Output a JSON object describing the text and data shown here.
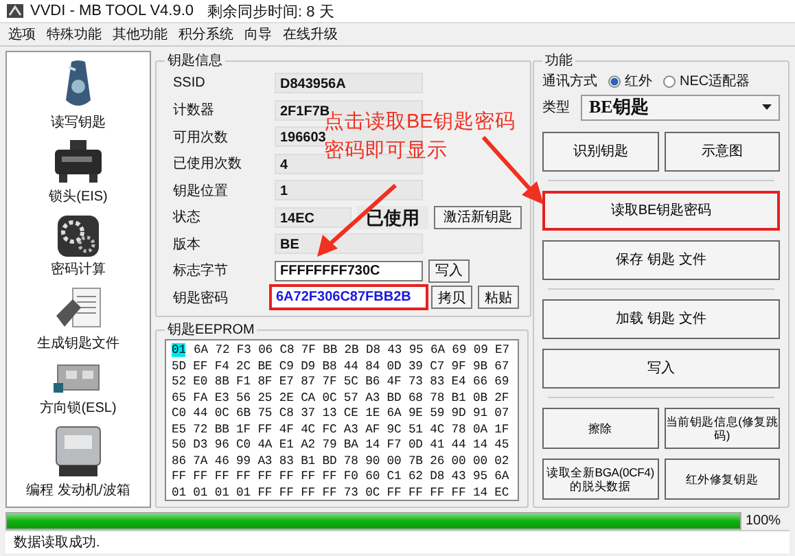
{
  "window": {
    "title": "VVDI - MB TOOL V4.9.0",
    "sync": "剩余同步时间: 8 天"
  },
  "menu": [
    "选项",
    "特殊功能",
    "其他功能",
    "积分系统",
    "向导",
    "在线升级"
  ],
  "sidebar": {
    "items": [
      {
        "label": "读写钥匙"
      },
      {
        "label": "锁头(EIS)"
      },
      {
        "label": "密码计算"
      },
      {
        "label": "生成钥匙文件"
      },
      {
        "label": "方向锁(ESL)"
      },
      {
        "label": "编程 发动机/波箱"
      }
    ]
  },
  "key_info": {
    "title": "钥匙信息",
    "fields": [
      {
        "kind": "readonly",
        "label": "SSID",
        "value": "D843956A"
      },
      {
        "kind": "readonly",
        "label": "计数器",
        "value": "2F1F7B"
      },
      {
        "kind": "readonly",
        "label": "可用次数",
        "value": "196603"
      },
      {
        "kind": "readonly",
        "label": "已使用次数",
        "value": "4"
      },
      {
        "kind": "readonly",
        "label": "钥匙位置",
        "value": "1"
      },
      {
        "kind": "status",
        "label": "状态",
        "value": "14EC",
        "badge": "已使用",
        "buttons": [
          "激活新钥匙"
        ]
      },
      {
        "kind": "readonly",
        "label": "版本",
        "value": "BE"
      },
      {
        "kind": "input",
        "label": "标志字节",
        "value": "FFFFFFFF730C",
        "buttons": [
          "写入"
        ]
      },
      {
        "kind": "password",
        "label": "钥匙密码",
        "value": "6A72F306C87FBB2B",
        "highlighted": true,
        "buttons": [
          "拷贝",
          "粘贴"
        ]
      }
    ]
  },
  "eeprom": {
    "title": "钥匙EEPROM",
    "cursor": "01",
    "rows": [
      "6A 72 F3 06 C8 7F BB 2B D8 43 95 6A 69 09 E7",
      "5D EF F4 2C BE C9 D9 B8 44 84 0D 39 C7 9F 9B 67",
      "52 E0 8B F1 8F E7 87 7F 5C B6 4F 73 83 E4 66 69",
      "65 FA E3 56 25 2E CA 0C 57 A3 BD 68 78 B1 0B 2F",
      "C0 44 0C 6B 75 C8 37 13 CE 1E 6A 9E 59 9D 91 07",
      "E5 72 BB 1F FF 4F 4C FC A3 AF 9C 51 4C 78 0A 1F",
      "50 D3 96 C0 4A E1 A2 79 BA 14 F7 0D 41 44 14 45",
      "86 7A 46 99 A3 83 B1 BD 78 90 00 7B 26 00 00 02",
      "FF FF FF FF FF FF FF FF F0 60 C1 62 D8 43 95 6A",
      "01 01 01 01 FF FF FF FF 73 0C FF FF FF FF 14 EC"
    ]
  },
  "functions": {
    "title": "功能",
    "comm_label": "通讯方式",
    "comm_options": [
      {
        "label": "红外",
        "selected": true
      },
      {
        "label": "NEC适配器",
        "selected": false
      }
    ],
    "type_label": "类型",
    "type_value": "BE钥匙",
    "groups": [
      [
        {
          "buttons": [
            {
              "label": "识别钥匙",
              "highlighted": false
            },
            {
              "label": "示意图",
              "highlighted": false
            }
          ]
        }
      ],
      [
        {
          "buttons": [
            {
              "label": "读取BE钥匙密码",
              "highlighted": true
            }
          ]
        },
        {
          "buttons": [
            {
              "label": "保存 钥匙 文件",
              "highlighted": false
            }
          ]
        }
      ],
      [
        {
          "buttons": [
            {
              "label": "加载 钥匙 文件",
              "highlighted": false
            }
          ]
        },
        {
          "buttons": [
            {
              "label": "写入",
              "highlighted": false
            }
          ]
        }
      ],
      [
        {
          "buttons": [
            {
              "label": "擦除",
              "highlighted": false
            },
            {
              "label": "当前钥匙信息(修复跳码)",
              "highlighted": false
            }
          ]
        },
        {
          "buttons": [
            {
              "label": "读取全新BGA(0CF4)的脱头数据",
              "highlighted": false
            },
            {
              "label": "红外修复钥匙",
              "highlighted": false
            }
          ]
        }
      ]
    ]
  },
  "progress": {
    "level": 1,
    "reading": "100%"
  },
  "status_bar": "数据读取成功.",
  "annotation": {
    "lines": [
      "点击读取BE钥匙密码",
      "密码即可显示"
    ]
  }
}
